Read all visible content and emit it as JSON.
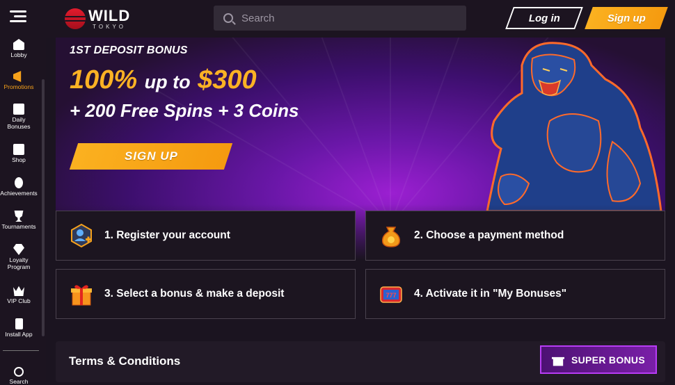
{
  "header": {
    "logo_main": "WILD",
    "logo_sub": "TOKYO",
    "search_placeholder": "Search",
    "login_label": "Log in",
    "signup_label": "Sign up"
  },
  "sidebar": {
    "items": [
      {
        "label": "Lobby",
        "icon": "home-icon"
      },
      {
        "label": "Promotions",
        "icon": "megaphone-icon",
        "active": true
      },
      {
        "label": "Daily Bonuses",
        "icon": "calendar-icon"
      },
      {
        "label": "Shop",
        "icon": "shop-icon"
      },
      {
        "label": "Achievements",
        "icon": "medal-icon"
      },
      {
        "label": "Tournaments",
        "icon": "trophy-icon"
      },
      {
        "label": "Loyalty Program",
        "icon": "diamond-icon"
      },
      {
        "label": "VIP Club",
        "icon": "crown-icon"
      },
      {
        "label": "Install App",
        "icon": "phone-icon"
      },
      {
        "label": "Search",
        "icon": "search-icon"
      }
    ],
    "active_color": "#f7a21b"
  },
  "hero": {
    "label": "1ST DEPOSIT BONUS",
    "percent": "100%",
    "upto": "up to",
    "amount": "$300",
    "line2": "+ 200 Free Spins + 3 Coins",
    "cta": "SIGN UP"
  },
  "steps": [
    {
      "text": "1. Register your account",
      "icon": "user-add-icon"
    },
    {
      "text": "2. Choose a payment method",
      "icon": "money-bag-icon"
    },
    {
      "text": "3. Select a bonus & make a deposit",
      "icon": "gift-icon"
    },
    {
      "text": "4. Activate it in \"My Bonuses\"",
      "icon": "slot-machine-icon"
    }
  ],
  "terms": {
    "title": "Terms & Conditions",
    "super_bonus": "SUPER BONUS"
  },
  "colors": {
    "accent": "#fbb120",
    "bg": "#1b1420",
    "purple": "#7a1fa8"
  }
}
